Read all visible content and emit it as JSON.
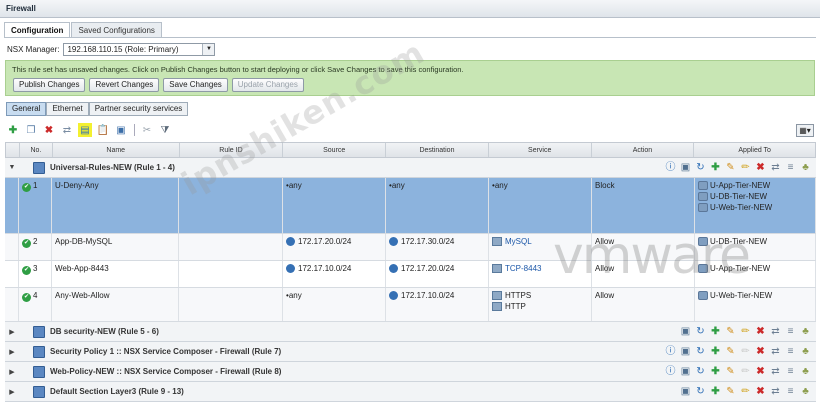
{
  "window": {
    "title": "Firewall"
  },
  "tabs": [
    {
      "label": "Configuration"
    },
    {
      "label": "Saved Configurations"
    }
  ],
  "nsx": {
    "label": "NSX Manager:",
    "selected": "192.168.110.15 (Role: Primary)"
  },
  "banner": {
    "message": "This rule set has unsaved changes. Click on Publish Changes button to start deploying or click Save Changes to save this configuration.",
    "buttons": [
      "Publish Changes",
      "Revert Changes",
      "Save Changes",
      "Update Changes"
    ]
  },
  "subtabs": [
    "General",
    "Ethernet",
    "Partner security services"
  ],
  "columns": [
    "No.",
    "Name",
    "Rule ID",
    "Source",
    "Destination",
    "Service",
    "Action",
    "Applied To"
  ],
  "sections": [
    {
      "title": "Universal-Rules-NEW (Rule 1 - 4)",
      "expanded": true
    },
    {
      "title": "DB security-NEW (Rule 5 - 6)"
    },
    {
      "title": "Security Policy 1 :: NSX Service Composer - Firewall (Rule 7)"
    },
    {
      "title": "Web-Policy-NEW :: NSX Service Composer - Firewall (Rule 8)"
    },
    {
      "title": "Default Section Layer3 (Rule 9 - 13)"
    }
  ],
  "rules": [
    {
      "no": "1",
      "name": "U-Deny-Any",
      "rule_id": "",
      "source": [
        "any"
      ],
      "destination": [
        "any"
      ],
      "service": [
        "any"
      ],
      "action": "Block",
      "applied_to": [
        "U-App-Tier-NEW",
        "U-DB-Tier-NEW",
        "U-Web-Tier-NEW"
      ]
    },
    {
      "no": "2",
      "name": "App-DB-MySQL",
      "rule_id": "",
      "source": [
        "172.17.20.0/24"
      ],
      "destination": [
        "172.17.30.0/24"
      ],
      "service": [
        "MySQL"
      ],
      "action": "Allow",
      "applied_to": [
        "U-DB-Tier-NEW"
      ]
    },
    {
      "no": "3",
      "name": "Web-App-8443",
      "rule_id": "",
      "source": [
        "172.17.10.0/24"
      ],
      "destination": [
        "172.17.20.0/24"
      ],
      "service": [
        "TCP-8443"
      ],
      "action": "Allow",
      "applied_to": [
        "U-App-Tier-NEW"
      ]
    },
    {
      "no": "4",
      "name": "Any-Web-Allow",
      "rule_id": "",
      "source": [
        "any"
      ],
      "destination": [
        "172.17.10.0/24"
      ],
      "service": [
        "HTTPS",
        "HTTP"
      ],
      "action": "Allow",
      "applied_to": [
        "U-Web-Tier-NEW"
      ]
    }
  ],
  "watermark": "ipnshiken.com",
  "brand": "vmware",
  "colors": {
    "banner": "#c8e6b4",
    "selected_row": "#8cb3dd",
    "enabled": "#2f9e44",
    "toolbar_highlight": "#f3f030"
  }
}
